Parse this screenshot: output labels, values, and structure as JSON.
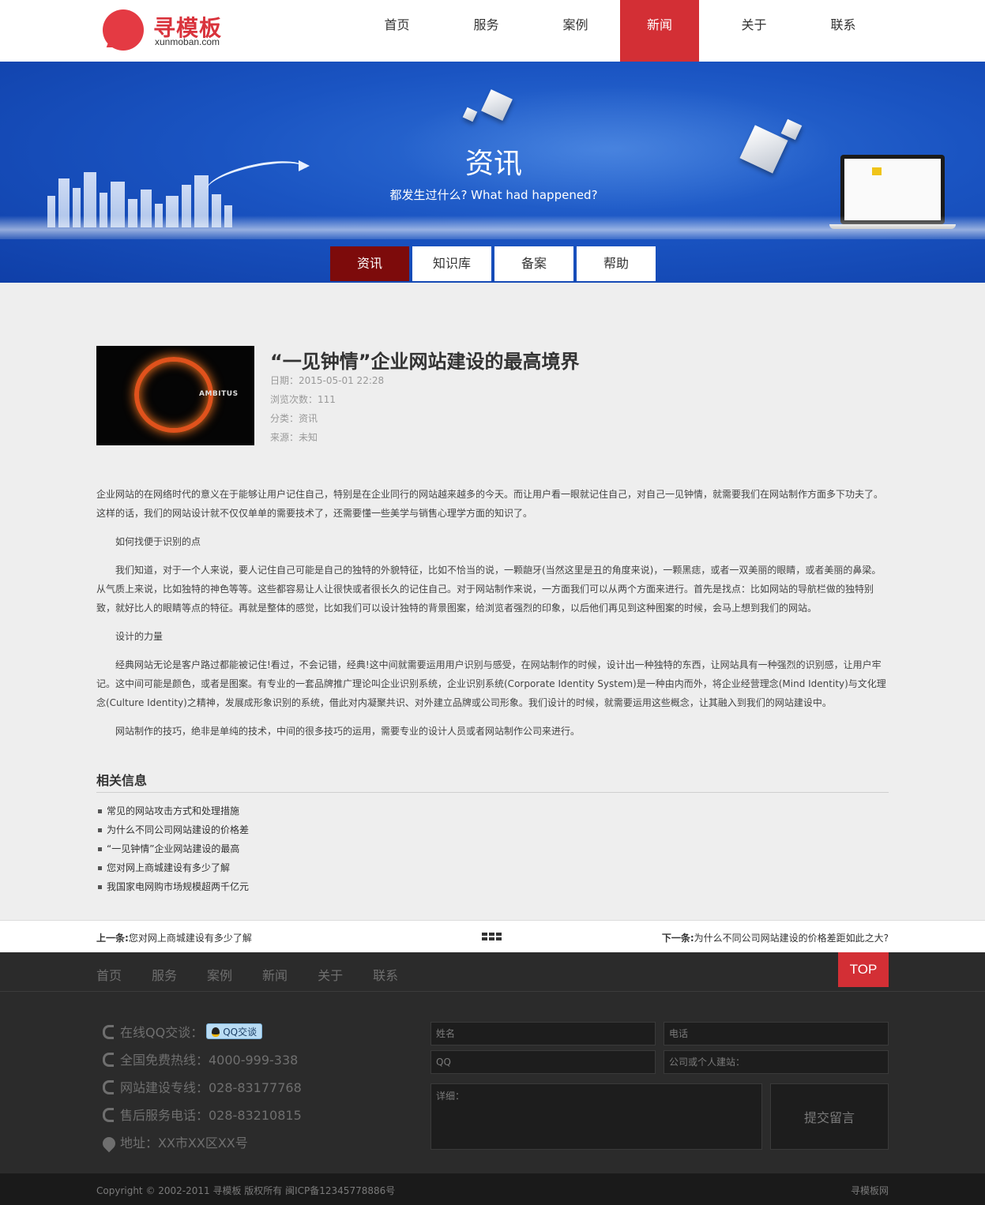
{
  "logo": {
    "name": "寻模板",
    "domain": "xunmoban.com"
  },
  "nav": {
    "items": [
      {
        "label": "首页",
        "active": false
      },
      {
        "label": "服务",
        "active": false
      },
      {
        "label": "案例",
        "active": false
      },
      {
        "label": "新闻",
        "active": true
      },
      {
        "label": "关于",
        "active": false
      },
      {
        "label": "联系",
        "active": false
      }
    ]
  },
  "banner": {
    "title": "资讯",
    "subtitle": "都发生过什么? What had happened?"
  },
  "subnav": {
    "items": [
      {
        "label": "资讯",
        "active": true
      },
      {
        "label": "知识库",
        "active": false
      },
      {
        "label": "备案",
        "active": false
      },
      {
        "label": "帮助",
        "active": false
      }
    ]
  },
  "article": {
    "thumb_text": "AMBITUS",
    "title": "“一见钟情”企业网站建设的最高境界",
    "date": "日期：2015-05-01 22:28",
    "views": "浏览次数：111",
    "category": "分类：资讯",
    "source": "来源：未知",
    "paragraphs": [
      "企业网站的在网络时代的意义在于能够让用户记住自己，特别是在企业同行的网站越来越多的今天。而让用户看一眼就记住自己，对自己一见钟情，就需要我们在网站制作方面多下功夫了。这样的话，我们的网站设计就不仅仅单单的需要技术了，还需要懂一些美学与销售心理学方面的知识了。",
      "如何找便于识别的点",
      "我们知道，对于一个人来说，要人记住自己可能是自己的独特的外貌特征，比如不恰当的说，一颗龅牙(当然这里是丑的角度来说)，一颗黑痣，或者一双美丽的眼睛，或者美丽的鼻梁。从气质上来说，比如独特的神色等等。这些都容易让人让很快或者很长久的记住自己。对于网站制作来说，一方面我们可以从两个方面来进行。首先是找点：比如网站的导航栏做的独特别致，就好比人的眼睛等点的特征。再就是整体的感觉，比如我们可以设计独特的背景图案，给浏览者强烈的印象，以后他们再见到这种图案的时候，会马上想到我们的网站。",
      "设计的力量",
      "经典网站无论是客户路过都能被记住!看过，不会记错，经典!这中间就需要运用用户识别与感受，在网站制作的时候，设计出一种独特的东西，让网站具有一种强烈的识别感，让用户牢记。这中间可能是颜色，或者是图案。有专业的一套品牌推广理论叫企业识别系统，企业识别系统(Corporate Identity System)是一种由内而外，将企业经营理念(Mind Identity)与文化理念(Culture Identity)之精神，发展成形象识别的系统，借此对内凝聚共识、对外建立品牌或公司形象。我们设计的时候，就需要运用这些概念，让其融入到我们的网站建设中。",
      "网站制作的技巧，绝非是单纯的技术，中间的很多技巧的运用，需要专业的设计人员或者网站制作公司来进行。"
    ]
  },
  "related": {
    "title": "相关信息",
    "items": [
      "常见的网站攻击方式和处理措施",
      "为什么不同公司网站建设的价格差",
      "“一见钟情”企业网站建设的最高",
      "您对网上商城建设有多少了解",
      "我国家电网购市场规模超两千亿元"
    ]
  },
  "pager": {
    "prev_label": "上一条:",
    "prev_title": "您对网上商城建设有多少了解",
    "next_label": "下一条:",
    "next_title": "为什么不同公司网站建设的价格差距如此之大?"
  },
  "footer": {
    "nav": [
      "首页",
      "服务",
      "案例",
      "新闻",
      "关于",
      "联系"
    ],
    "top_label": "TOP",
    "qq_label": "在线QQ交谈：",
    "qq_badge": "QQ交谈",
    "hotline": "全国免费热线：4000-999-338",
    "build_line": "网站建设专线：028-83177768",
    "service_line": "售后服务电话：028-83210815",
    "address": "地址：XX市XX区XX号",
    "form": {
      "name_placeholder": "姓名",
      "phone_placeholder": "电话",
      "qq_placeholder": "QQ",
      "site_placeholder": "公司或个人建站：",
      "detail_placeholder": "详细：",
      "submit_label": "提交留言"
    },
    "copyright": "Copyright © 2002-2011 寻模板 版权所有   闽ICP备12345778886号",
    "brand": "寻模板网"
  }
}
